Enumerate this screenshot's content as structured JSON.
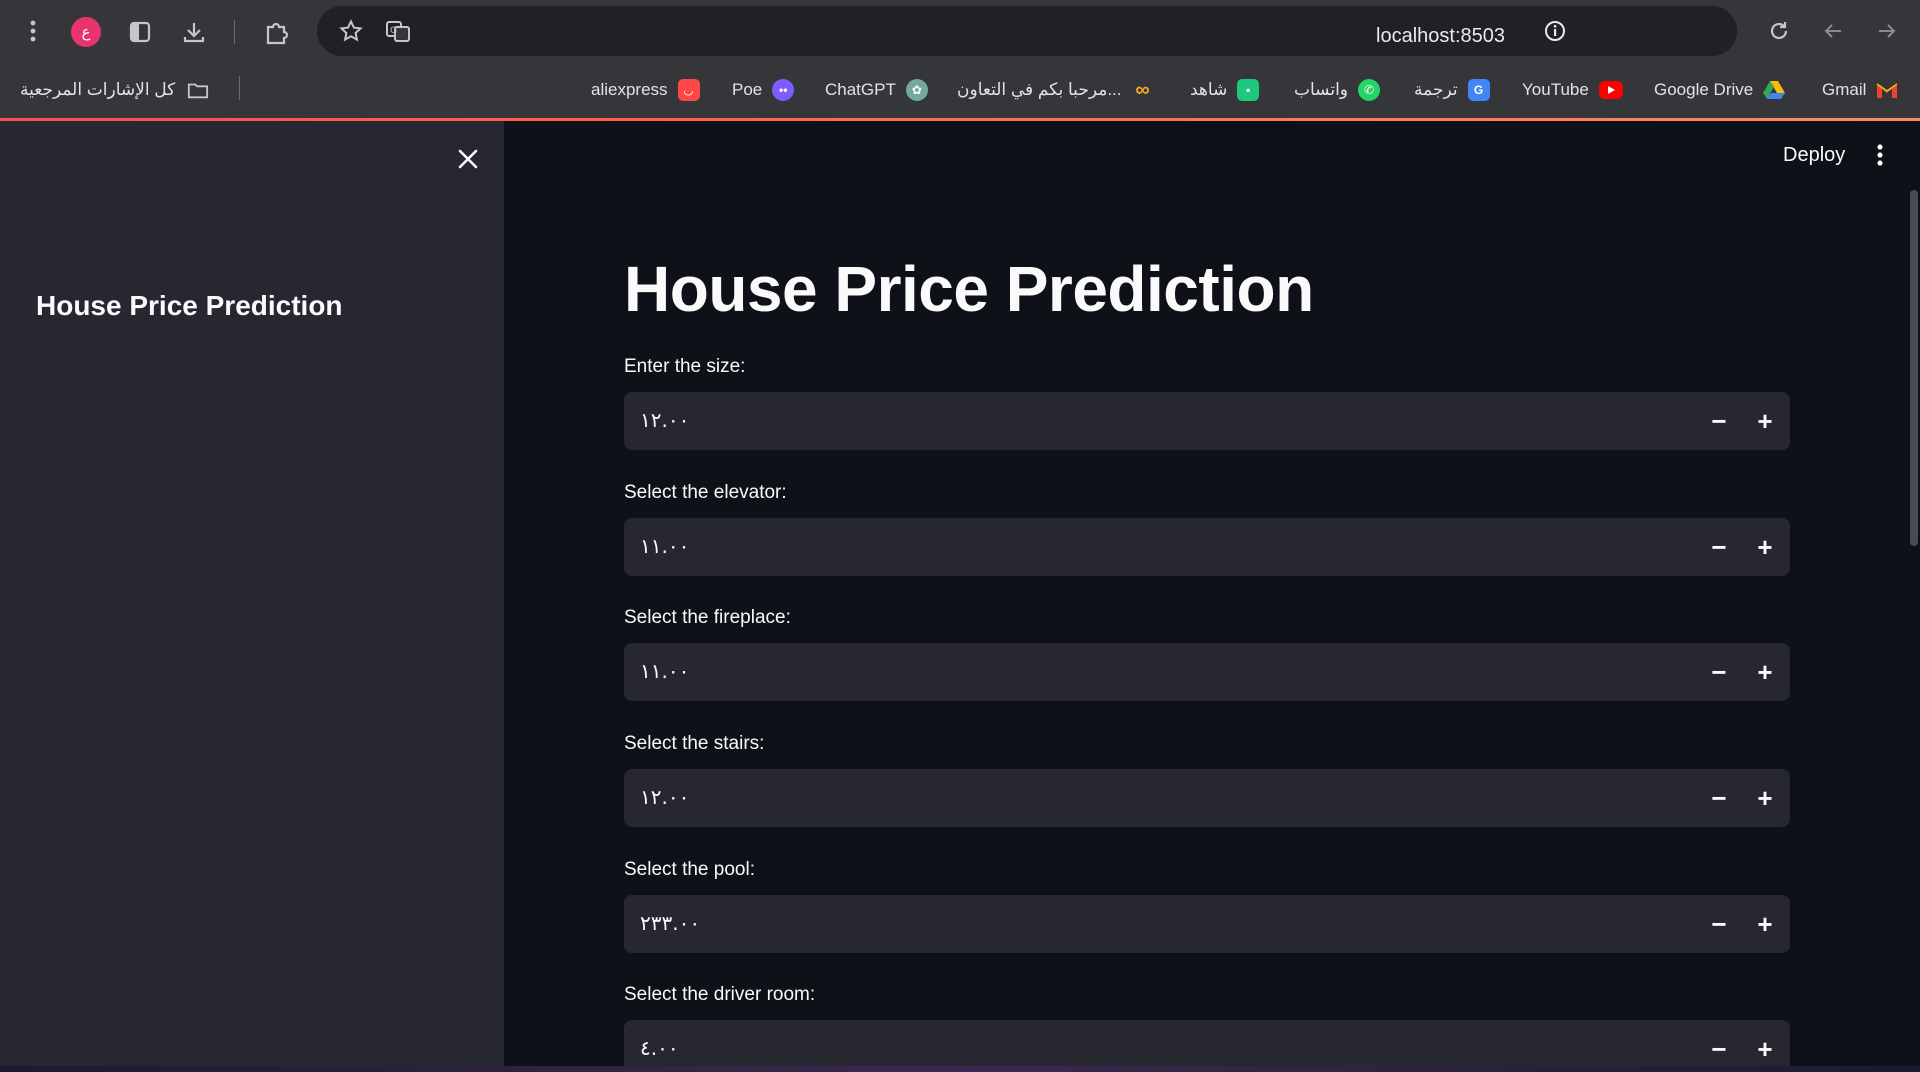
{
  "browser": {
    "profile_initial": "ع",
    "url": "localhost:8503",
    "bookmarks_all_label": "كل الإشارات المرجعية",
    "bookmarks": [
      {
        "label": "Gmail",
        "icon": "gmail-icon",
        "color": "#ea4335"
      },
      {
        "label": "Google Drive",
        "icon": "google-drive-icon",
        "color": "#34a853"
      },
      {
        "label": "YouTube",
        "icon": "youtube-icon",
        "color": "#ff0000"
      },
      {
        "label": "ترجمة",
        "icon": "translate-icon",
        "color": "#4285f4"
      },
      {
        "label": "واتساب",
        "icon": "whatsapp-icon",
        "color": "#25d366"
      },
      {
        "label": "شاهد",
        "icon": "shahid-icon",
        "color": "#1ec97e"
      },
      {
        "label": "مرحبا بكم في التعاون...",
        "icon": "infinity-icon",
        "color": "#f5a623"
      },
      {
        "label": "ChatGPT",
        "icon": "chatgpt-icon",
        "color": "#74aa9c"
      },
      {
        "label": "Poe",
        "icon": "poe-icon",
        "color": "#7c5cff"
      },
      {
        "label": "aliexpress",
        "icon": "aliexpress-icon",
        "color": "#ff4747"
      }
    ]
  },
  "header": {
    "deploy_label": "Deploy"
  },
  "sidebar": {
    "title": "House Price Prediction"
  },
  "main": {
    "title": "House Price Prediction",
    "fields": [
      {
        "label": "Enter the size:",
        "value": "١٢.٠٠"
      },
      {
        "label": "Select the elevator:",
        "value": "١١.٠٠"
      },
      {
        "label": "Select the fireplace:",
        "value": "١١.٠٠"
      },
      {
        "label": "Select the stairs:",
        "value": "١٢.٠٠"
      },
      {
        "label": "Select the pool:",
        "value": "٢٣٣.٠٠"
      },
      {
        "label": "Select the driver room:",
        "value": "٤.٠٠"
      }
    ],
    "minus_symbol": "−",
    "plus_symbol": "+"
  },
  "colors": {
    "accent": "#ff4b4b",
    "background": "#0e1117",
    "sidebar": "#262730"
  }
}
